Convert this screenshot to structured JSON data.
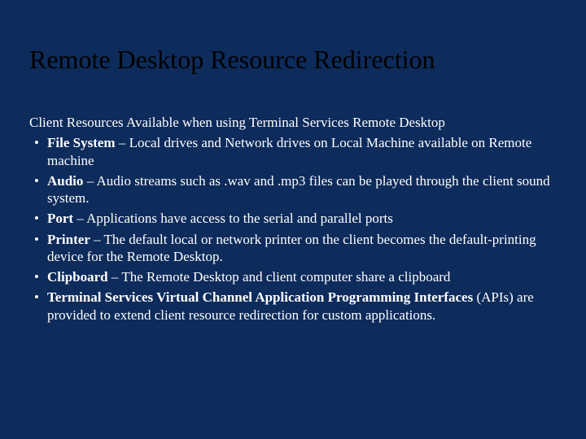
{
  "slide": {
    "title": "Remote Desktop Resource Redirection",
    "intro": "Client Resources Available when using Terminal Services Remote Desktop",
    "bullets": [
      {
        "bold": "File System",
        "rest": " – Local drives and Network drives on Local Machine available on Remote machine"
      },
      {
        "bold": "Audio",
        "rest": " – Audio streams such as .wav and .mp3 files can be played through the client sound system."
      },
      {
        "bold": "Port",
        "rest": " – Applications have access to the serial and parallel ports"
      },
      {
        "bold": "Printer",
        "rest": " – The default local or network printer on the client becomes the default-printing device for the Remote Desktop."
      },
      {
        "bold": "Clipboard",
        "rest": " – The Remote Desktop and client computer share a clipboard"
      },
      {
        "bold": "Terminal Services Virtual Channel Application Programming Interfaces",
        "rest": " (APIs) are provided to extend client resource redirection for custom applications."
      }
    ]
  }
}
